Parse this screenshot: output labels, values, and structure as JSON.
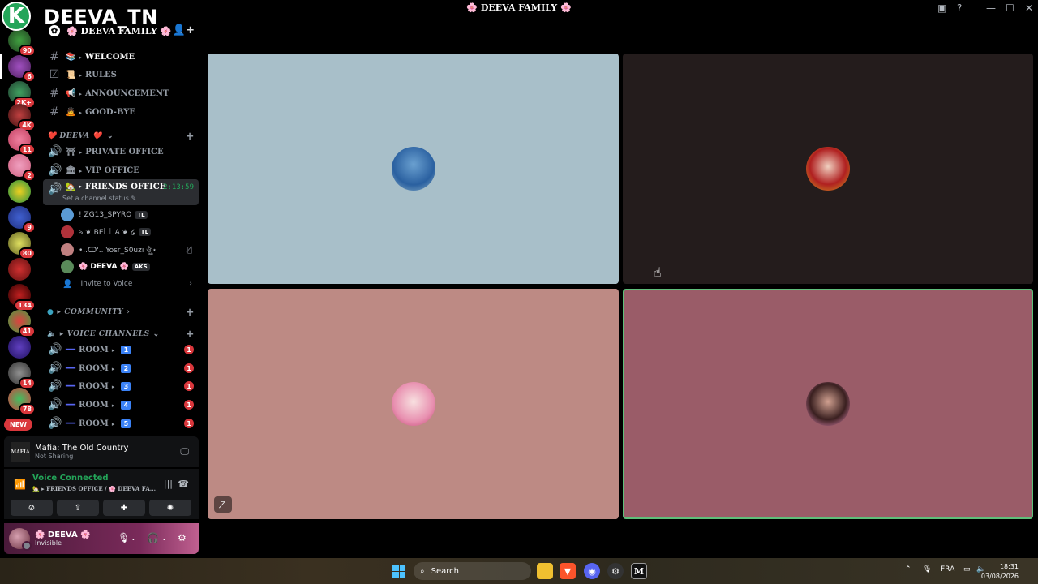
{
  "app": {
    "brand_letter": "K",
    "brand_name": "DEEVA_TN",
    "window_title": "DEEVA FAMILY",
    "window_title_prefix": "🌸",
    "window_title_suffix": "🌸"
  },
  "server_rail": {
    "badges": [
      "90",
      "6",
      "2K+",
      "4K",
      "11",
      "2",
      "9",
      "80",
      "134",
      "41",
      "14",
      "78"
    ],
    "new_label": "NEW"
  },
  "guild": {
    "name": "🌸 DEEVA FAMILY 🌸"
  },
  "channels": [
    {
      "icon": "#",
      "emoji": "📚",
      "name": "WELCOME",
      "bright": true
    },
    {
      "icon": "☑",
      "emoji": "📜",
      "name": "RULES",
      "bright": false
    },
    {
      "icon": "#",
      "emoji": "📢",
      "name": "ANNOUNCEMENT",
      "bright": false
    },
    {
      "icon": "#",
      "emoji": "🙇",
      "name": "GOOD-BYE",
      "bright": false
    }
  ],
  "category_deeva": "❤️ DEEVA ❤️",
  "voice_offices": [
    {
      "emoji": "⛩",
      "name": "PRIVATE OFFICE"
    },
    {
      "emoji": "🏛",
      "name": "VIP OFFICE"
    },
    {
      "emoji": "🏡",
      "name": "FRIENDS OFFICE",
      "timer": "2:13:59",
      "status_hint": "Set a channel status"
    }
  ],
  "voice_users": [
    {
      "name": "! ZG13_SPYRO",
      "tag": "TL",
      "color": "#5b9bd5"
    },
    {
      "name": "ঌ ❦ BE꒒꒒A ❦ ໒",
      "tag": "TL",
      "color": "#b0323a"
    },
    {
      "name": "•..ↀ'.. Yosr_S0uzi ঔৣ⋆",
      "tag": "",
      "color": "#c08080"
    },
    {
      "name": "🌸 DEEVA 🌸",
      "tag": "AKS",
      "color": "#5a8a5a"
    }
  ],
  "invite_label": "Invite to Voice",
  "category_community": "COMMUNITY",
  "category_voice": "VOICE CHANNELS",
  "rooms": [
    {
      "name": "ROOM",
      "num": "1",
      "count": "1"
    },
    {
      "name": "ROOM",
      "num": "2",
      "count": "1"
    },
    {
      "name": "ROOM",
      "num": "3",
      "count": "1"
    },
    {
      "name": "ROOM",
      "num": "4",
      "count": "1"
    },
    {
      "name": "ROOM",
      "num": "5",
      "count": "1"
    }
  ],
  "activity": {
    "game_icon": "MAFIA",
    "title": "Mafia: The Old Country",
    "subtitle": "Not Sharing"
  },
  "voice_status": {
    "title": "Voice Connected",
    "location": "🏡 ▸ FRIENDS OFFICE / 🌸 DEEVA FA..."
  },
  "user": {
    "name": "🌸 DEEVA 🌸",
    "status": "Invisible"
  },
  "tiles": [
    {
      "bg": "#a8bfc9",
      "avatar": "#3a7ab0",
      "highlight": false
    },
    {
      "bg": "#241c1c",
      "avatar": "#b03030",
      "highlight": false
    },
    {
      "bg": "#bd8a84",
      "avatar": "#e8b0c0",
      "highlight": false
    },
    {
      "bg": "#9a5c68",
      "avatar": "#d890b8",
      "highlight": true
    }
  ],
  "taskbar": {
    "search": "Search",
    "lang": "FRA",
    "time": "18:31",
    "date": "03/08/2026"
  }
}
